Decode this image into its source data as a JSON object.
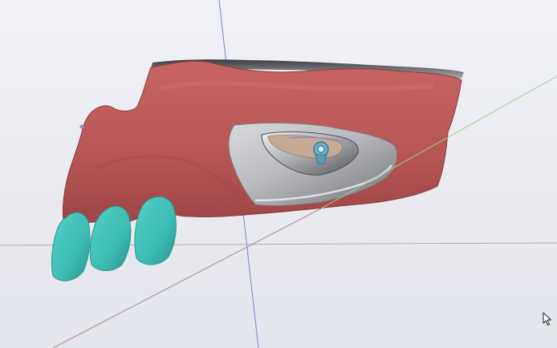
{
  "scene": {
    "background_top": "#f1f2f6",
    "background_bottom": "#e3e5ec",
    "axis_colors": {
      "vertical": "#7d7fbf",
      "horizontal": "#b8a8a8",
      "diagonal_near": "#b08a8a",
      "diagonal_far": "#9ed08c"
    },
    "model": {
      "name": "jaw-model",
      "gingiva_color": "#b85656",
      "gingiva_shadow": "#8f3a3a",
      "tooth_color": "#3cbcb4",
      "tooth_shadow": "#2a9790",
      "guide_metal_color": "#c9cacd",
      "guide_metal_dark": "#6f7074",
      "implant_color": "#6aaec8",
      "bone_color": "#c7a995",
      "tooth_count": 3
    }
  },
  "cursor": {
    "icon": "pointer-arrow-icon"
  }
}
